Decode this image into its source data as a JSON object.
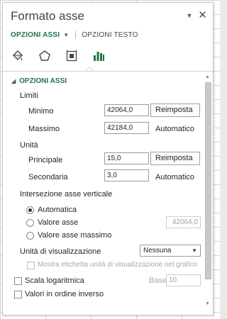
{
  "pane": {
    "title": "Formato asse",
    "tab_active": "OPZIONI ASSI",
    "tab_inactive": "OPZIONI TESTO"
  },
  "section_title": "OPZIONI ASSI",
  "limiti": {
    "heading": "Limiti",
    "min_label": "Minimo",
    "min_value": "42064,0",
    "min_button": "Reimposta",
    "max_label": "Massimo",
    "max_value": "42184,0",
    "max_status": "Automatico"
  },
  "unita": {
    "heading": "Unità",
    "main_label": "Principale",
    "main_value": "15,0",
    "main_button": "Reimposta",
    "minor_label": "Secondaria",
    "minor_value": "3,0",
    "minor_status": "Automatico"
  },
  "intersezione": {
    "heading": "Intersezione asse verticale",
    "opt_auto": "Automatica",
    "opt_value": "Valore asse",
    "value_field": "42064,0",
    "opt_max": "Valore asse massimo"
  },
  "display_units": {
    "label": "Unità di visualizzazione",
    "selected": "Nessuna",
    "show_label": "Mostra etichetta unità di visualizzazione nel grafico"
  },
  "log_scale": {
    "label": "Scala logaritmica",
    "base_label": "Base",
    "base_value": "10"
  },
  "reverse": {
    "label": "Valori in ordine inverso"
  },
  "icons": [
    "fill-line-icon",
    "effects-icon",
    "size-properties-icon",
    "axis-options-icon"
  ],
  "colors": {
    "accent": "#217346"
  }
}
